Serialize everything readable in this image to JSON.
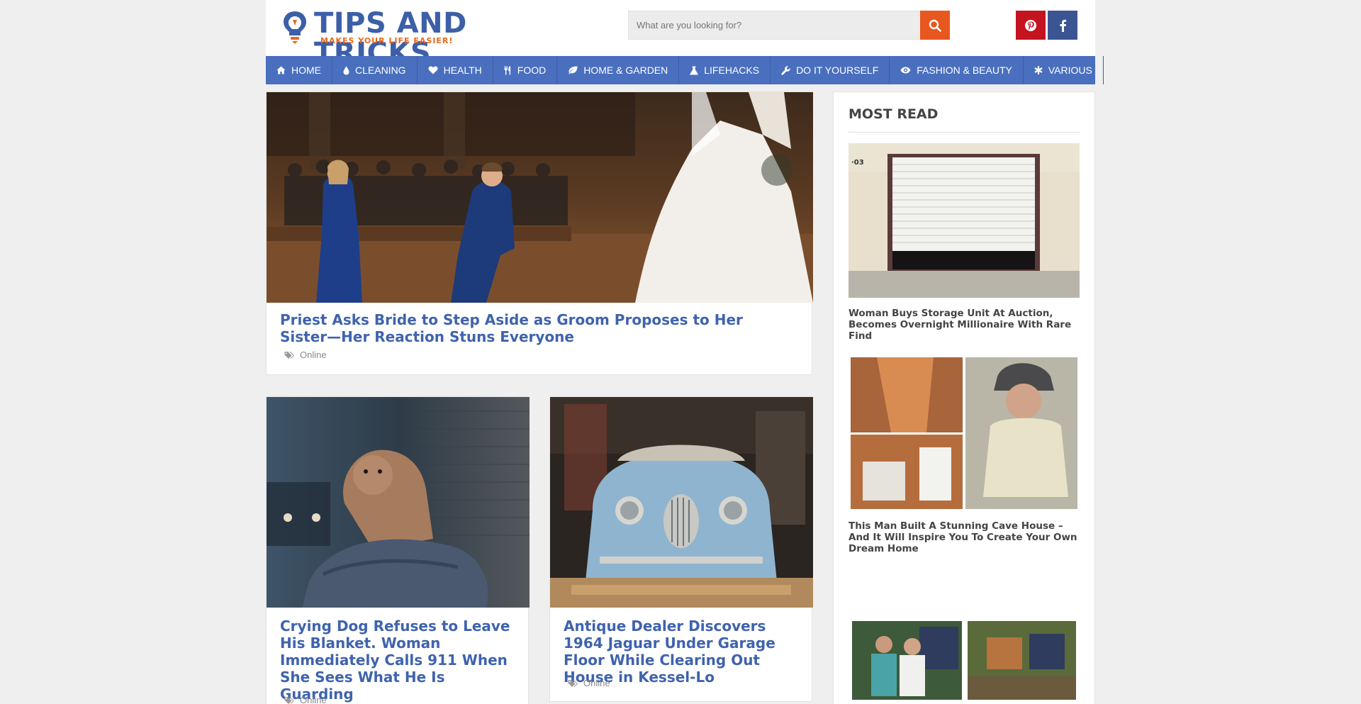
{
  "site": {
    "logo_title": "TIPS AND TRICKS",
    "logo_subtitle": "MAKES YOUR LIFE EASIER!",
    "brand_blue": "#3c5fa8",
    "brand_orange": "#e8691f"
  },
  "search": {
    "placeholder": "What are you looking for?",
    "button_icon": "search-icon"
  },
  "social": [
    {
      "name": "pinterest",
      "icon": "pinterest-icon",
      "color": "#c4141f"
    },
    {
      "name": "facebook",
      "icon": "facebook-icon",
      "color": "#3b5593"
    }
  ],
  "nav": {
    "items": [
      {
        "label": "HOME",
        "icon": "home-icon"
      },
      {
        "label": "CLEANING",
        "icon": "drop-icon"
      },
      {
        "label": "HEALTH",
        "icon": "heart-icon"
      },
      {
        "label": "FOOD",
        "icon": "cutlery-icon"
      },
      {
        "label": "HOME & GARDEN",
        "icon": "leaf-icon"
      },
      {
        "label": "LIFEHACKS",
        "icon": "flask-icon"
      },
      {
        "label": "DO IT YOURSELF",
        "icon": "wrench-icon"
      },
      {
        "label": "FASHION & BEAUTY",
        "icon": "eye-icon"
      },
      {
        "label": "VARIOUS",
        "icon": "asterisk-icon"
      }
    ]
  },
  "articles": [
    {
      "title": "Priest Asks Bride to Step Aside as Groom Proposes to Her Sister—Her Reaction Stuns Everyone",
      "tag": "Online"
    },
    {
      "title": "Crying Dog Refuses to Leave His Blanket. Woman Immediately Calls 911 When She Sees What He Is Guarding",
      "tag": "Online"
    },
    {
      "title": "Antique Dealer Discovers 1964 Jaguar Under Garage Floor While Clearing Out House in Kessel-Lo",
      "tag": "Online"
    }
  ],
  "sidebar": {
    "heading": "MOST READ",
    "items": [
      {
        "title": "Woman Buys Storage Unit At Auction, Becomes Overnight Millionaire With Rare Find"
      },
      {
        "title": "This Man Built A Stunning Cave House – And It Will Inspire You To Create Your Own Dream Home"
      }
    ]
  }
}
